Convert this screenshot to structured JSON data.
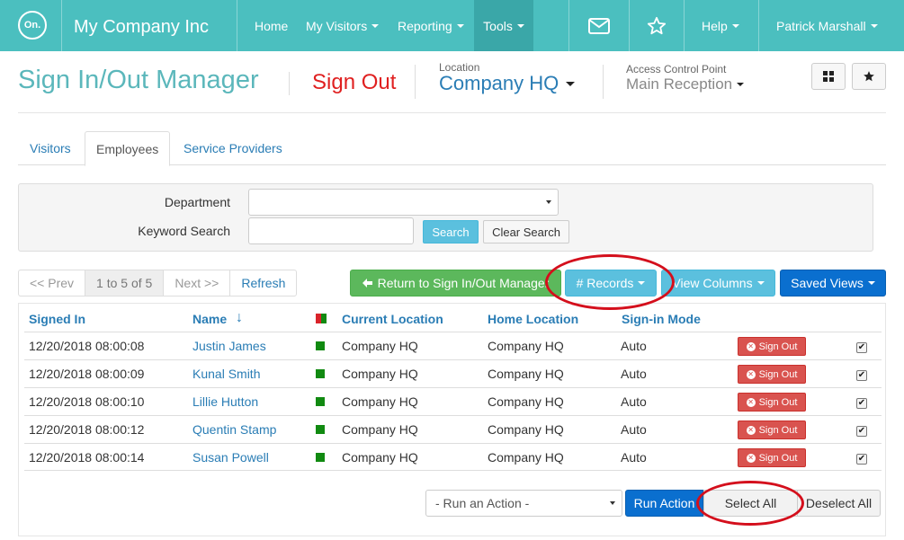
{
  "nav": {
    "logo_text": "On.",
    "brand": "My Company Inc",
    "items": [
      {
        "label": "Home",
        "has_caret": false
      },
      {
        "label": "My Visitors",
        "has_caret": true
      },
      {
        "label": "Reporting",
        "has_caret": true
      },
      {
        "label": "Tools",
        "has_caret": true,
        "active": true
      }
    ],
    "icons": [
      "envelope-icon",
      "star-icon"
    ],
    "help": "Help",
    "user": "Patrick Marshall",
    "bg_color": "#4bbfbf"
  },
  "header": {
    "title": "Sign In/Out Manager",
    "mode": "Sign Out",
    "location_label": "Location",
    "location_value": "Company HQ",
    "acp_label": "Access Control Point",
    "acp_value": "Main Reception"
  },
  "tabs": [
    {
      "label": "Visitors",
      "active": false
    },
    {
      "label": "Employees",
      "active": true
    },
    {
      "label": "Service Providers",
      "active": false
    }
  ],
  "filter": {
    "department_label": "Department",
    "department_value": "",
    "keyword_label": "Keyword Search",
    "keyword_value": "",
    "search_btn": "Search",
    "clear_btn": "Clear Search"
  },
  "pager": {
    "prev": "<< Prev",
    "current": "1 to 5 of 5",
    "next": "Next >>",
    "refresh": "Refresh"
  },
  "actions": {
    "return": "Return to Sign In/Out Manager",
    "records": "# Records",
    "columns": "View Columns",
    "saved_views": "Saved Views"
  },
  "table": {
    "columns": [
      "Signed In",
      "Name",
      "Current Location",
      "Home Location",
      "Sign-in Mode"
    ],
    "sort_indicator": "↓",
    "row_button": "Sign Out",
    "rows": [
      {
        "signed_in": "12/20/2018 08:00:08",
        "name": "Justin James",
        "current": "Company HQ",
        "home": "Company HQ",
        "mode": "Auto"
      },
      {
        "signed_in": "12/20/2018 08:00:09",
        "name": "Kunal Smith",
        "current": "Company HQ",
        "home": "Company HQ",
        "mode": "Auto"
      },
      {
        "signed_in": "12/20/2018 08:00:10",
        "name": "Lillie Hutton",
        "current": "Company HQ",
        "home": "Company HQ",
        "mode": "Auto"
      },
      {
        "signed_in": "12/20/2018 08:00:12",
        "name": "Quentin Stamp",
        "current": "Company HQ",
        "home": "Company HQ",
        "mode": "Auto"
      },
      {
        "signed_in": "12/20/2018 08:00:14",
        "name": "Susan Powell",
        "current": "Company HQ",
        "home": "Company HQ",
        "mode": "Auto"
      }
    ]
  },
  "bottom": {
    "run_action_placeholder": "- Run an Action -",
    "run_action_btn": "Run Action",
    "select_all": "Select All",
    "deselect_all": "Deselect All"
  }
}
